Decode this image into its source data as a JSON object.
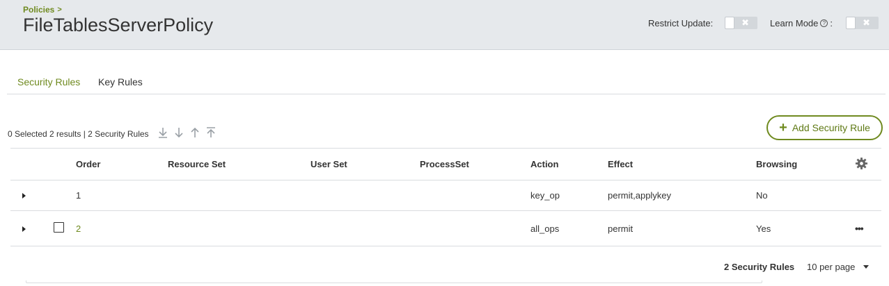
{
  "header": {
    "breadcrumb": "Policies",
    "title": "FileTablesServerPolicy",
    "restrict_update_label": "Restrict Update:",
    "learn_mode_label": "Learn Mode",
    "learn_mode_suffix": ":"
  },
  "tabs": [
    {
      "label": "Security Rules",
      "active": true
    },
    {
      "label": "Key Rules",
      "active": false
    }
  ],
  "toolbar": {
    "results_text": "0 Selected 2 results | 2 Security Rules",
    "add_button_label": "Add Security Rule"
  },
  "table": {
    "columns": [
      "Order",
      "Resource Set",
      "User Set",
      "ProcessSet",
      "Action",
      "Effect",
      "Browsing"
    ],
    "rows": [
      {
        "order": "1",
        "resource_set": "",
        "user_set": "",
        "process_set": "",
        "action": "key_op",
        "effect": "permit,applykey",
        "browsing": "No"
      },
      {
        "order": "2",
        "resource_set": "",
        "user_set": "",
        "process_set": "",
        "action": "all_ops",
        "effect": "permit",
        "browsing": "Yes"
      }
    ]
  },
  "footer": {
    "count_text": "2 Security Rules",
    "per_page": "10 per page"
  },
  "colors": {
    "accent": "#6f8a1f",
    "header_bg": "#e6e9ec"
  }
}
